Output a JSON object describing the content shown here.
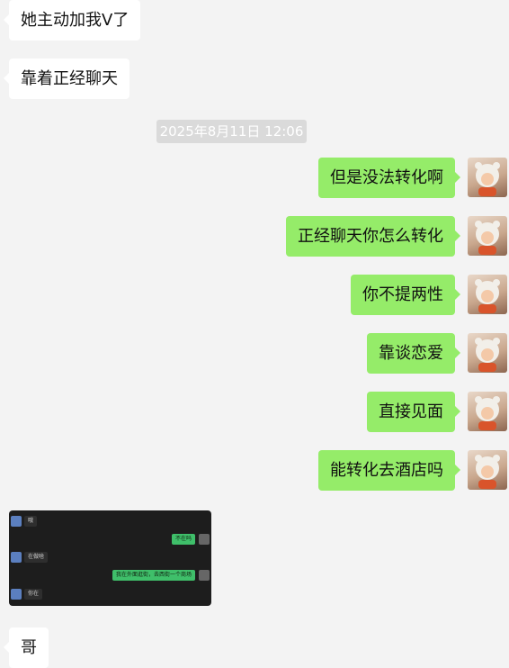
{
  "messages_in_top": [
    {
      "text": "她主动加我V了"
    },
    {
      "text": "靠着正经聊天"
    }
  ],
  "timestamp": "2025年8月11日 12:06",
  "messages_out": [
    {
      "text": "但是没法转化啊"
    },
    {
      "text": "正经聊天你怎么转化"
    },
    {
      "text": "你不提两性"
    },
    {
      "text": "靠谈恋爱"
    },
    {
      "text": "直接见面"
    },
    {
      "text": "能转化去酒店吗"
    }
  ],
  "image_message": {
    "rows": [
      {
        "side": "in",
        "text": "哦"
      },
      {
        "side": "out",
        "text": "不在吗"
      },
      {
        "side": "in",
        "text": "在做啥"
      },
      {
        "side": "out",
        "text": "我在外面逛街，去西街一个商场"
      },
      {
        "side": "in",
        "text": "你在"
      }
    ]
  },
  "messages_in_bottom": [
    {
      "text": "哥"
    }
  ],
  "colors": {
    "background": "#f3f3f3",
    "outgoing": "#95ec69",
    "incoming": "#ffffff"
  },
  "icons": {
    "avatar": "cartoon-tiger-hood-avatar"
  }
}
